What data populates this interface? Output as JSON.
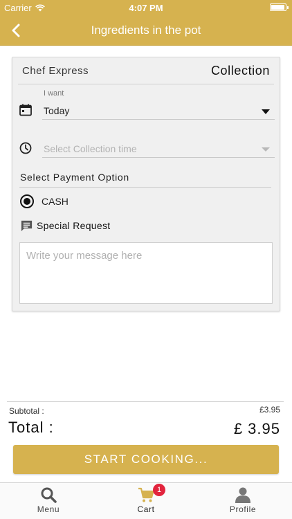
{
  "status_bar": {
    "carrier": "Carrier",
    "time": "4:07 PM"
  },
  "nav": {
    "title": "Ingredients in the pot",
    "back_icon": "chevron-left-icon"
  },
  "order": {
    "restaurant_name": "Chef Express",
    "mode": "Collection",
    "date_field": {
      "label": "I want",
      "value": "Today",
      "icon": "calendar-icon"
    },
    "time_field": {
      "placeholder": "Select Collection time",
      "icon": "clock-icon"
    },
    "payment": {
      "title": "Select Payment Option",
      "options": [
        {
          "label": "CASH",
          "selected": true
        }
      ]
    },
    "special_request": {
      "label": "Special Request",
      "icon": "message-icon",
      "placeholder": "Write your message here"
    }
  },
  "totals": {
    "subtotal_label": "Subtotal :",
    "subtotal_value": "£3.95",
    "total_label": "Total :",
    "total_value": "£ 3.95"
  },
  "cta_label": "START COOKING...",
  "tabs": [
    {
      "label": "Menu",
      "icon": "search-icon"
    },
    {
      "label": "Cart",
      "icon": "cart-icon",
      "badge": "1",
      "active": true
    },
    {
      "label": "Profile",
      "icon": "profile-icon"
    }
  ],
  "colors": {
    "brand": "#d6b24f",
    "badge": "#e2243d"
  }
}
